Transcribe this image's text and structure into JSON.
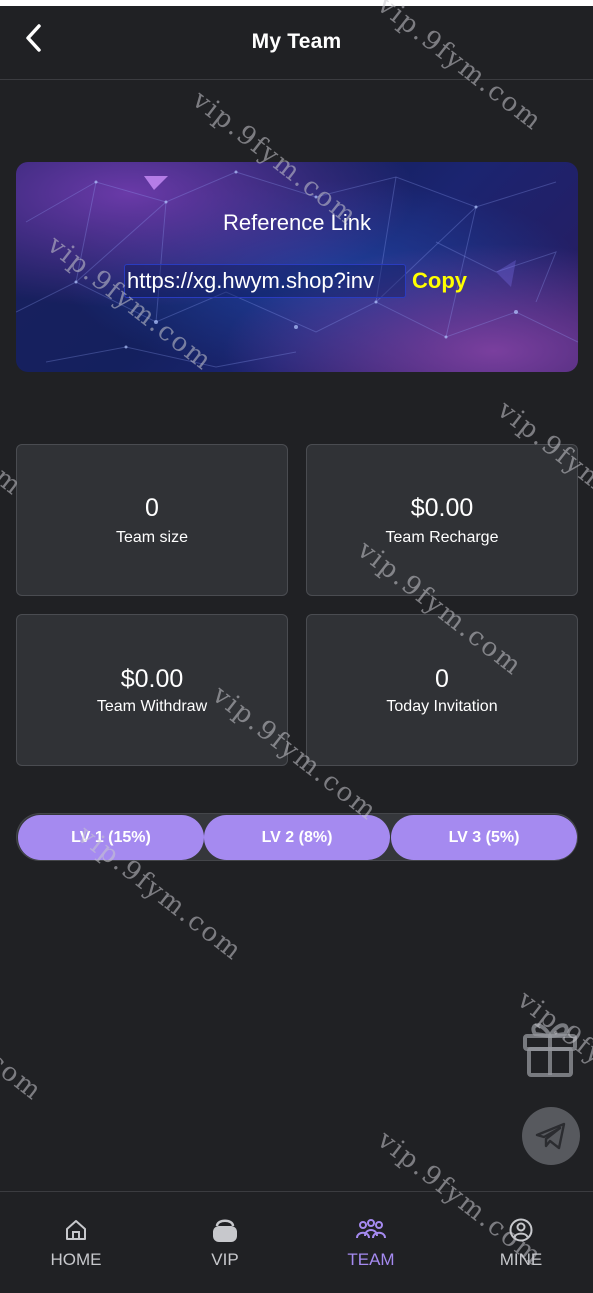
{
  "header": {
    "title": "My Team"
  },
  "reference": {
    "title": "Reference Link",
    "link": "https://xg.hwym.shop?inv",
    "copy_label": "Copy"
  },
  "stats": [
    {
      "value": "0",
      "label": "Team size"
    },
    {
      "value": "$0.00",
      "label": "Team Recharge"
    },
    {
      "value": "$0.00",
      "label": "Team Withdraw"
    },
    {
      "value": "0",
      "label": "Today Invitation"
    }
  ],
  "levels": [
    {
      "label": "LV 1 (15%)"
    },
    {
      "label": "LV 2 (8%)"
    },
    {
      "label": "LV 3 (5%)"
    }
  ],
  "tabs": [
    {
      "label": "HOME",
      "icon": "home-icon"
    },
    {
      "label": "VIP",
      "icon": "vip-basket-icon"
    },
    {
      "label": "TEAM",
      "icon": "team-icon"
    },
    {
      "label": "MINE",
      "icon": "user-icon"
    }
  ],
  "watermark": "vip.9fym.com",
  "colors": {
    "accent": "#a58af0",
    "copy": "#ffff00",
    "background": "#202124",
    "card": "#303236"
  }
}
